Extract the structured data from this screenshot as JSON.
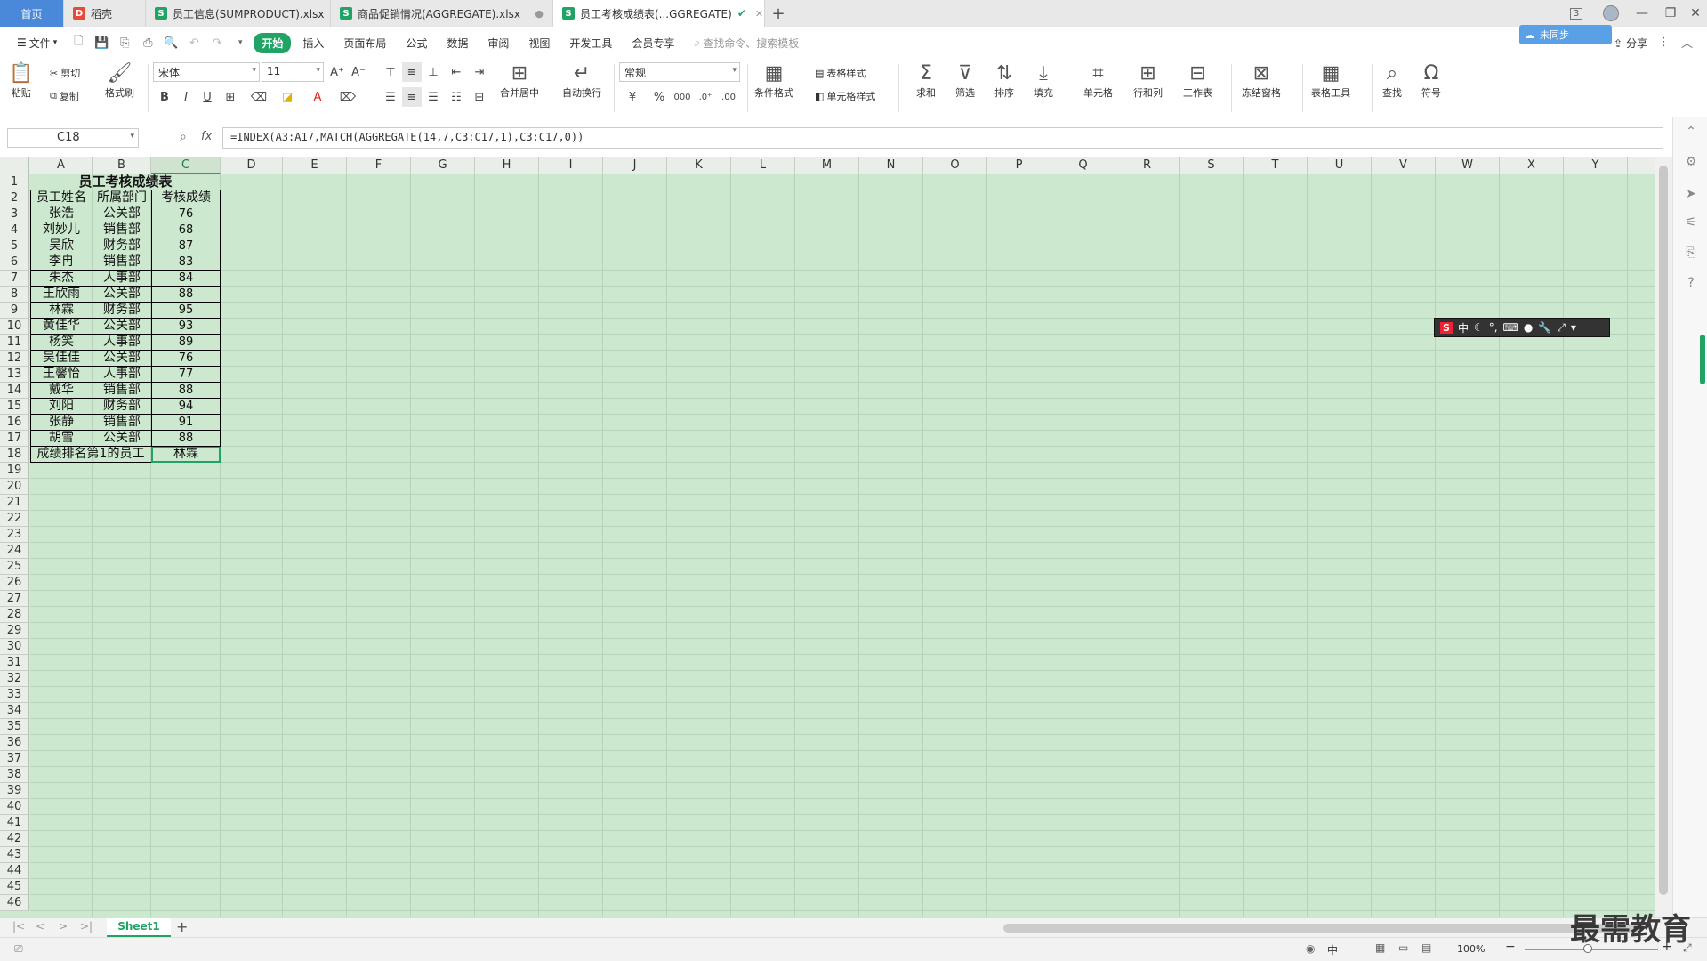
{
  "tabs": [
    {
      "label": "首页",
      "type": "home"
    },
    {
      "label": "稻壳",
      "icon": "docer",
      "color": "#e64a3a"
    },
    {
      "label": "员工信息(SUMPRODUCT).xlsx",
      "icon": "S",
      "color": "#21a366"
    },
    {
      "label": "商品促销情况(AGGREGATE).xlsx",
      "icon": "S",
      "color": "#21a366"
    },
    {
      "label": "员工考核成绩表(...GGREGATE)",
      "icon": "S",
      "color": "#21a366",
      "active": true
    }
  ],
  "window": {
    "badge": "3"
  },
  "menu": {
    "file": "文件",
    "items": [
      "开始",
      "插入",
      "页面布局",
      "公式",
      "数据",
      "审阅",
      "视图",
      "开发工具",
      "会员专享"
    ],
    "selected": "开始",
    "search_placeholder": "查找命令、搜索模板",
    "share": "分享",
    "cloud": "未同步"
  },
  "ribbon": {
    "paste": "粘贴",
    "cut": "剪切",
    "copy": "复制",
    "format_painter": "格式刷",
    "font_name": "宋体",
    "font_size": "11",
    "merge_center": "合并居中",
    "wrap": "自动换行",
    "number_format": "常规",
    "cond_format": "条件格式",
    "table_style": "表格样式",
    "cell_style": "单元格样式",
    "sum": "求和",
    "filter": "筛选",
    "sort": "排序",
    "fill": "填充",
    "cell": "单元格",
    "row_col": "行和列",
    "worksheet": "工作表",
    "freeze": "冻结窗格",
    "table_tools": "表格工具",
    "find": "查找",
    "symbol": "符号"
  },
  "formula_bar": {
    "name_box": "C18",
    "fx": "fx",
    "formula": "=INDEX(A3:A17,MATCH(AGGREGATE(14,7,C3:C17,1),C3:C17,0))"
  },
  "grid": {
    "columns": [
      "A",
      "B",
      "C",
      "D",
      "E",
      "F",
      "G",
      "H",
      "I",
      "J",
      "K",
      "L",
      "M",
      "N",
      "O",
      "P",
      "Q",
      "R",
      "S",
      "T",
      "U",
      "V",
      "W",
      "X",
      "Y"
    ],
    "selected_col": "C",
    "row_count": 46
  },
  "sheet": {
    "title": "员工考核成绩表",
    "headers": [
      "员工姓名",
      "所属部门",
      "考核成绩"
    ],
    "rows": [
      [
        "张浩",
        "公关部",
        "76"
      ],
      [
        "刘妙儿",
        "销售部",
        "68"
      ],
      [
        "吴欣",
        "财务部",
        "87"
      ],
      [
        "李冉",
        "销售部",
        "83"
      ],
      [
        "朱杰",
        "人事部",
        "84"
      ],
      [
        "王欣雨",
        "公关部",
        "88"
      ],
      [
        "林霖",
        "财务部",
        "95"
      ],
      [
        "黄佳华",
        "公关部",
        "93"
      ],
      [
        "杨笑",
        "人事部",
        "89"
      ],
      [
        "吴佳佳",
        "公关部",
        "76"
      ],
      [
        "王馨怡",
        "人事部",
        "77"
      ],
      [
        "戴华",
        "销售部",
        "88"
      ],
      [
        "刘阳",
        "财务部",
        "94"
      ],
      [
        "张静",
        "销售部",
        "91"
      ],
      [
        "胡雪",
        "公关部",
        "88"
      ]
    ],
    "result_label": "成绩排名第1的员工",
    "result_value": "林霖"
  },
  "sheet_tabs": {
    "active": "Sheet1",
    "add": "+"
  },
  "status": {
    "ime": "中",
    "zoom": "100%"
  },
  "ime_toolbar": {
    "s": "S",
    "lang": "中"
  },
  "watermark": "最需教育"
}
